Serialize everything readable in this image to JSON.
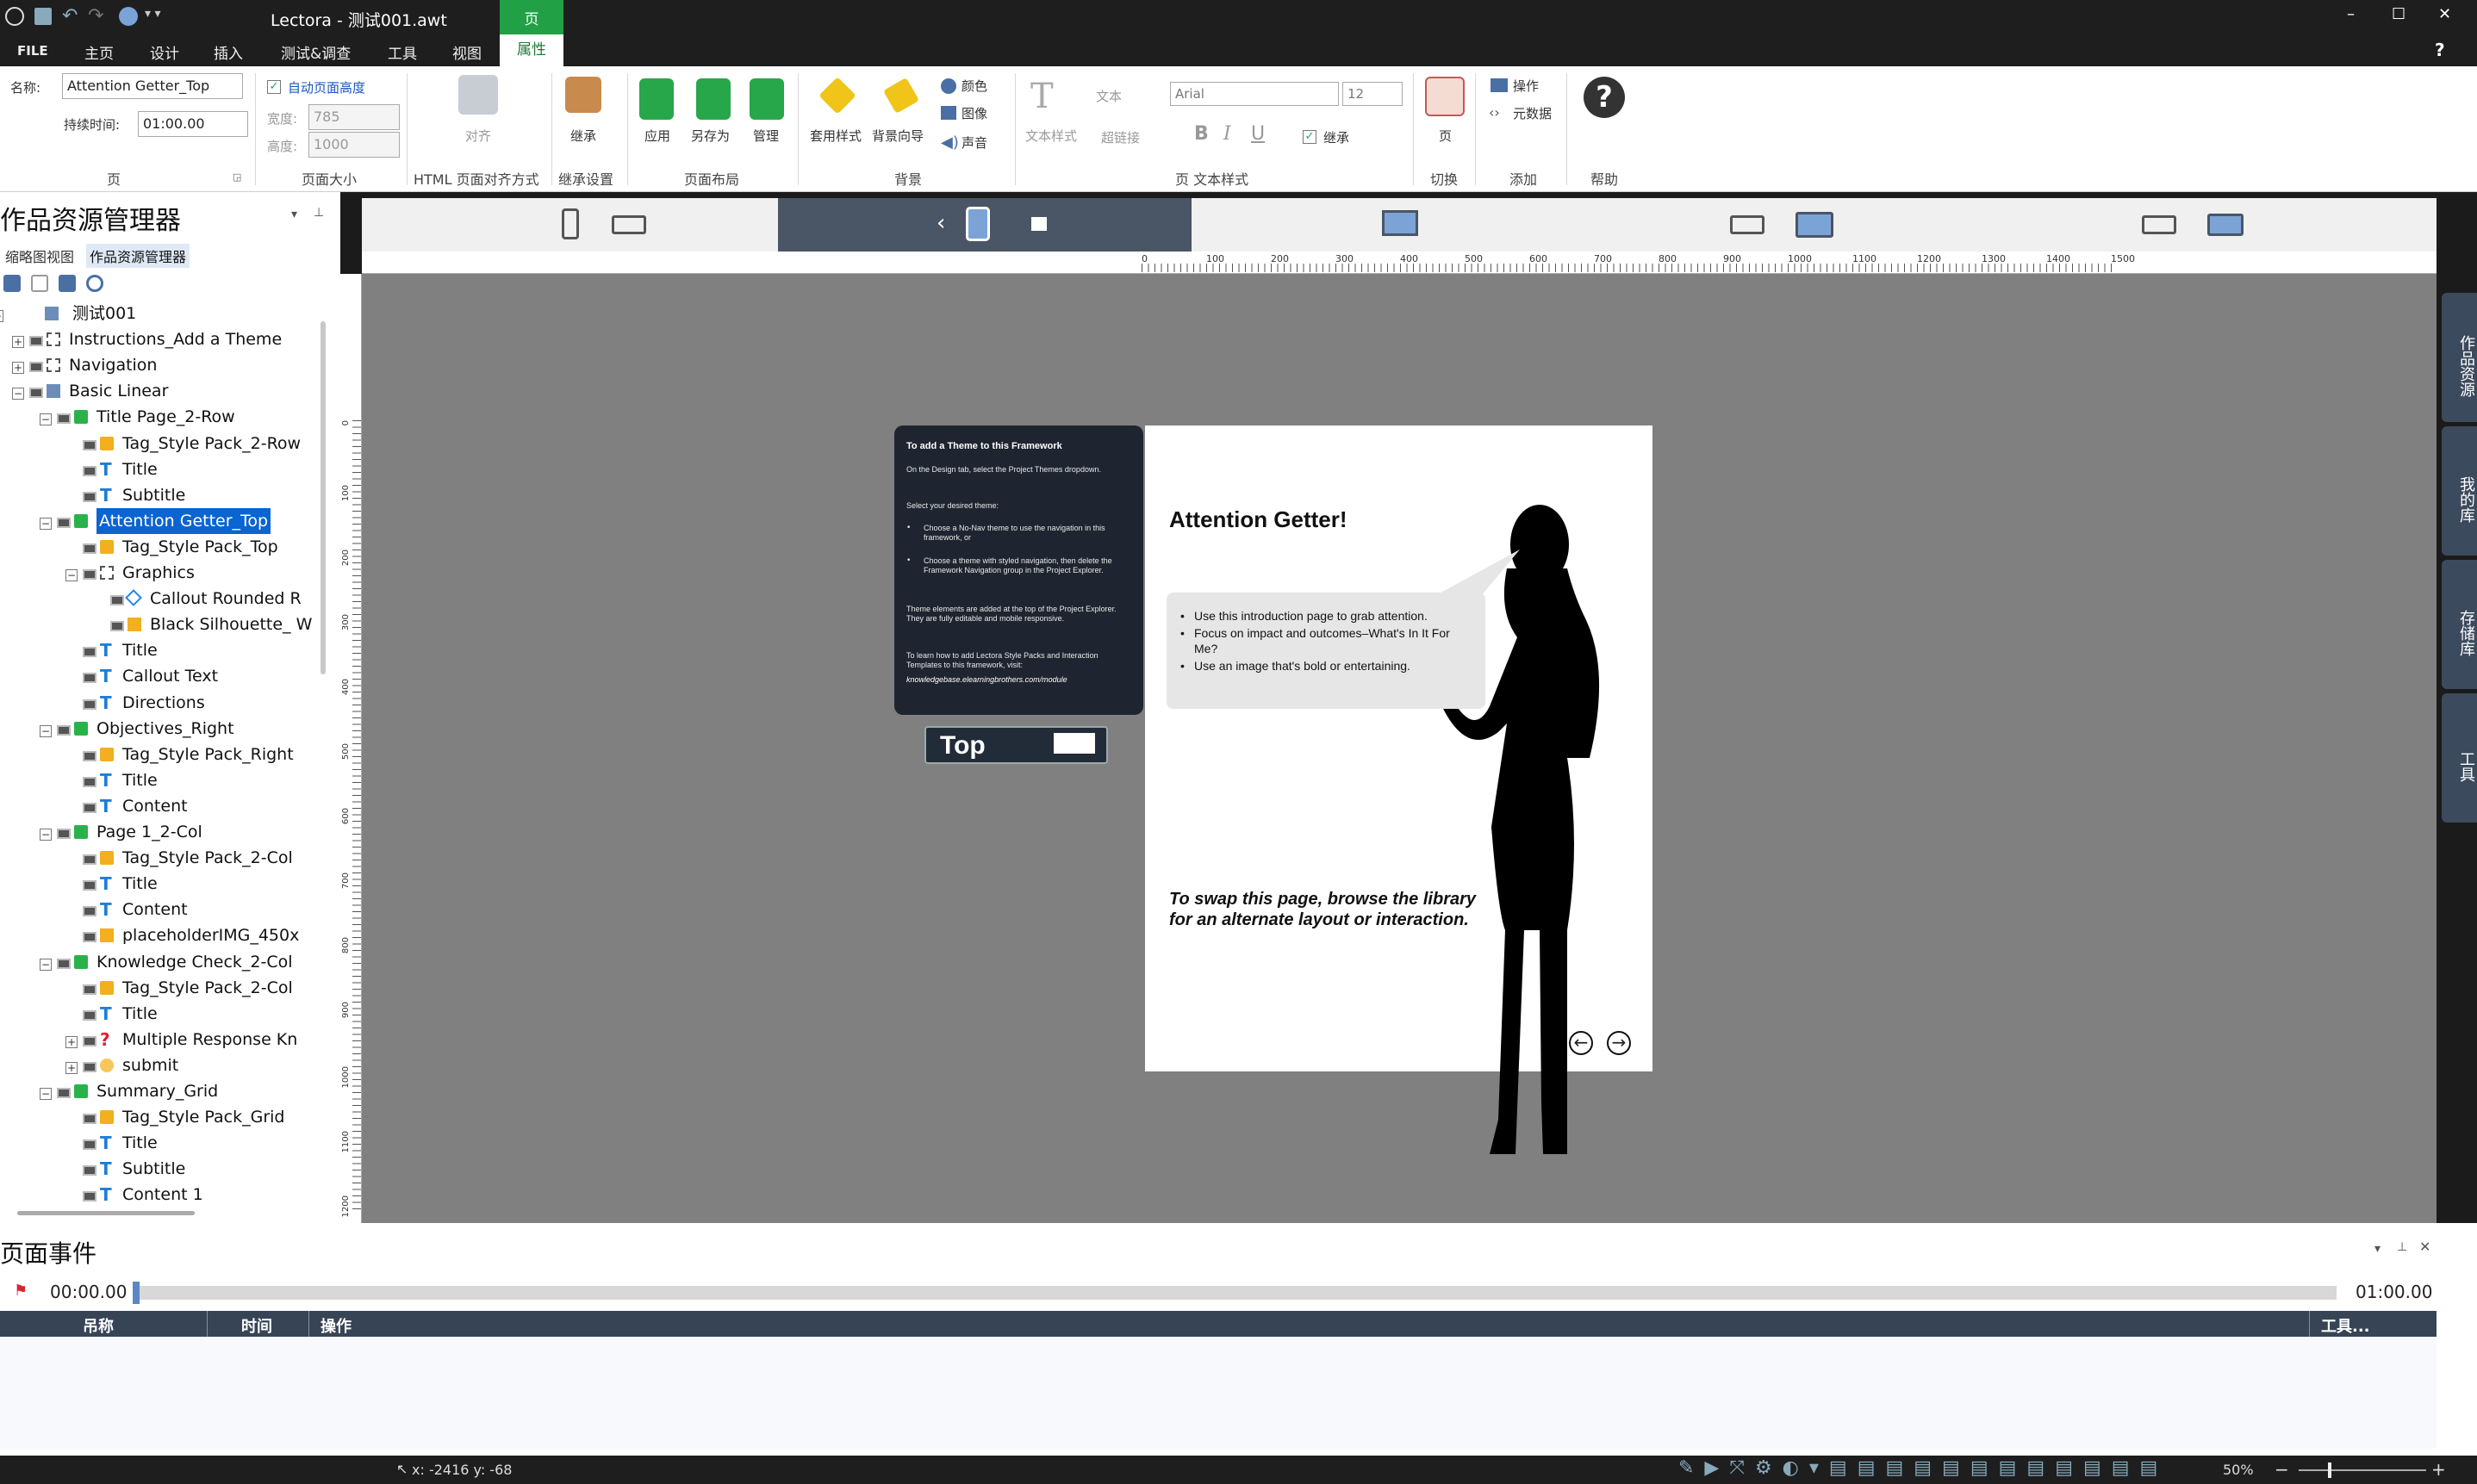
{
  "title_bar": {
    "app_title": "Lectora - 测试001.awt",
    "minimize": "–",
    "maximize": "☐",
    "close": "✕"
  },
  "menu": {
    "file": "FILE",
    "items": [
      "主页",
      "设计",
      "插入",
      "测试&调查",
      "工具",
      "视图",
      "属性"
    ],
    "context_tab": "页",
    "help": "?"
  },
  "ribbon": {
    "name_label": "名称:",
    "name_value": "Attention Getter_Top",
    "duration_label": "持续时间:",
    "duration_value": "01:00.00",
    "group_page": "页",
    "auto_height": "自动页面高度",
    "width_label": "宽度:",
    "width_value": "785",
    "height_label": "高度:",
    "height_value": "1000",
    "group_size": "页面大小",
    "align": "对齐",
    "group_html_align": "HTML 页面对齐方式",
    "inherit": "继承",
    "group_inherit": "继承设置",
    "apply": "应用",
    "save_as": "另存为",
    "manage": "管理",
    "group_layout": "页面布局",
    "apply_style": "套用样式",
    "bg_wizard": "背景向导",
    "color": "颜色",
    "image": "图像",
    "sound": "声音",
    "group_bg": "背景",
    "text_style": "文本样式",
    "text": "文本",
    "link": "超链接",
    "font": "Arial",
    "size": "12",
    "bold": "B",
    "italic": "I",
    "underline": "U",
    "inherit2": "继承",
    "group_text": "页 文本样式",
    "transition_page": "页",
    "group_transition": "切换",
    "action": "操作",
    "metadata": "元数据",
    "group_add": "添加",
    "group_help": "帮助"
  },
  "left_panel": {
    "title": "作品资源管理器",
    "tab_thumbs": "缩略图视图",
    "tab_explorer": "作品资源管理器",
    "tree": [
      {
        "label": "测试001",
        "icon": "book-icon"
      },
      {
        "label": "Instructions_Add a Theme",
        "icon": "group-icon"
      },
      {
        "label": "Navigation",
        "icon": "group-icon"
      },
      {
        "label": "Basic Linear",
        "icon": "folder-icon"
      },
      {
        "label": "Title Page_2-Row",
        "icon": "page-icon"
      },
      {
        "label": "Tag_Style Pack_2-Row",
        "icon": "tag-icon"
      },
      {
        "label": "Title",
        "icon": "text-icon"
      },
      {
        "label": "Subtitle",
        "icon": "text-icon"
      },
      {
        "label": "Attention Getter_Top",
        "icon": "page-icon"
      },
      {
        "label": "Tag_Style Pack_Top",
        "icon": "tag-icon"
      },
      {
        "label": "Graphics",
        "icon": "group-icon"
      },
      {
        "label": "Callout Rounded R",
        "icon": "shape-icon"
      },
      {
        "label": "Black Silhouette_ W",
        "icon": "image-icon"
      },
      {
        "label": "Title",
        "icon": "text-icon"
      },
      {
        "label": "Callout Text",
        "icon": "text-icon"
      },
      {
        "label": "Directions",
        "icon": "text-icon"
      },
      {
        "label": "Objectives_Right",
        "icon": "page-icon"
      },
      {
        "label": "Tag_Style Pack_Right",
        "icon": "tag-icon"
      },
      {
        "label": "Title",
        "icon": "text-icon"
      },
      {
        "label": "Content",
        "icon": "text-icon"
      },
      {
        "label": "Page 1_2-Col",
        "icon": "page-icon"
      },
      {
        "label": "Tag_Style Pack_2-Col",
        "icon": "tag-icon"
      },
      {
        "label": "Title",
        "icon": "text-icon"
      },
      {
        "label": "Content",
        "icon": "text-icon"
      },
      {
        "label": "placeholderIMG_450x",
        "icon": "image-icon"
      },
      {
        "label": "Knowledge Check_2-Col",
        "icon": "page-icon"
      },
      {
        "label": "Tag_Style Pack_2-Col",
        "icon": "tag-icon"
      },
      {
        "label": "Title",
        "icon": "text-icon"
      },
      {
        "label": "Multiple Response Kn",
        "icon": "question-icon"
      },
      {
        "label": "submit",
        "icon": "submit-icon"
      },
      {
        "label": "Summary_Grid",
        "icon": "page-icon"
      },
      {
        "label": "Tag_Style Pack_Grid",
        "icon": "tag-icon"
      },
      {
        "label": "Title",
        "icon": "text-icon"
      },
      {
        "label": "Subtitle",
        "icon": "text-icon"
      },
      {
        "label": "Content 1",
        "icon": "text-icon"
      }
    ]
  },
  "ruler": {
    "top": [
      "0",
      "100",
      "200",
      "300",
      "400",
      "500",
      "600",
      "700",
      "800",
      "900",
      "1000",
      "1100",
      "1200",
      "1300",
      "1400",
      "1500"
    ],
    "left": [
      "0",
      "100",
      "200",
      "300",
      "400",
      "500",
      "600",
      "700",
      "800",
      "900",
      "1000",
      "1100",
      "1200"
    ]
  },
  "canvas": {
    "panel_title": "To add a Theme to this Framework",
    "panel_p1": "On the Design tab, select the Project Themes dropdown.",
    "panel_p2": "Select your desired theme:",
    "panel_li1": "Choose a No-Nav theme to use the navigation in this framework, or",
    "panel_li2": "Choose a theme with styled navigation, then delete the Framework Navigation group in the Project Explorer.",
    "panel_p3": "Theme elements are added at the top of the Project Explorer. They are fully editable and mobile responsive.",
    "panel_p4": "To learn how to add Lectora Style Packs and Interaction Templates to this framework, visit:",
    "panel_link": "knowledgebase.elearningbrothers.com/module",
    "top_tag": "Top",
    "heading": "Attention Getter!",
    "bullets": [
      "Use this introduction page to grab attention.",
      "Focus on impact and outcomes–What's In It For Me?",
      "Use an image that's bold or entertaining."
    ],
    "directions": "To swap this page, browse the library for an alternate layout or interaction."
  },
  "right_tabs": [
    "作品资源",
    "我的库",
    "存储库",
    "工具"
  ],
  "events": {
    "title": "页面事件",
    "start_time": "00:00.00",
    "end_time": "01:00.00",
    "col_name": "吊称",
    "col_time": "时间",
    "col_action": "操作",
    "col_tools": "工具..."
  },
  "status": {
    "coords": "x: -2416  y: -68",
    "zoom": "50%",
    "minus": "−",
    "plus": "+"
  }
}
